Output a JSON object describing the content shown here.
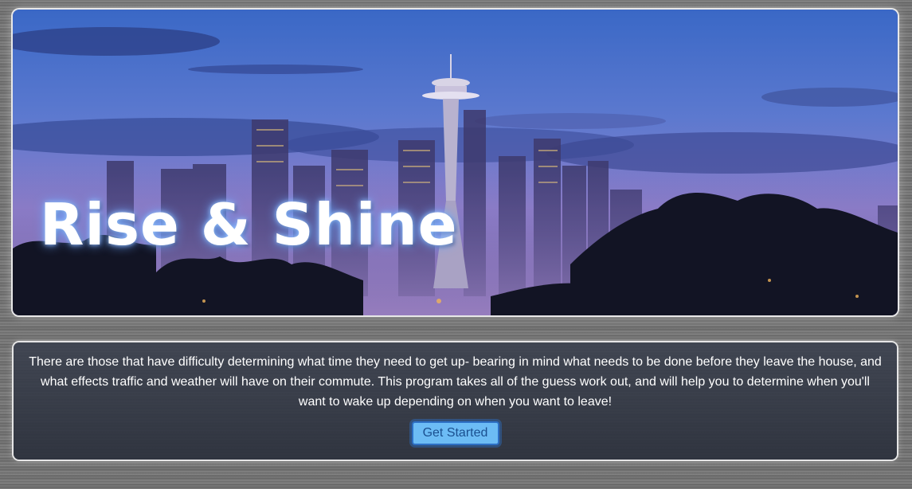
{
  "hero": {
    "title": "Rise & Shine"
  },
  "intro": {
    "text": "There are those that have difficulty determining what time they need to get up- bearing in mind what needs to be done before they leave the house, and what effects traffic and weather will have on their commute. This program takes all of the guess work out, and will help you to determine when you'll want to wake up depending on when you want to leave!",
    "cta_label": "Get Started"
  },
  "colors": {
    "sky_top": "#3f6fc8",
    "sky_bottom": "#8d7fd0",
    "title_glow": "#6aa6ff",
    "button_bg": "#6cbcf5",
    "button_border": "#2d6fc4",
    "panel_bg": "#3a404e"
  }
}
